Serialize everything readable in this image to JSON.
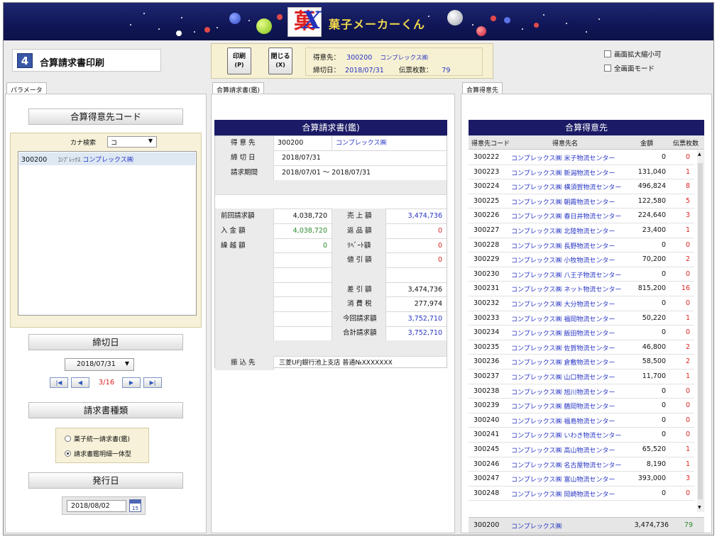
{
  "app": {
    "title": "菓子メーカーくん",
    "logo_text": "菓",
    "logo_x": "X"
  },
  "page": {
    "number": "4",
    "title": "合算請求書印刷"
  },
  "toolbar": {
    "print_label": "印刷",
    "print_key": "(P)",
    "close_label": "閉じる",
    "close_key": "(X)"
  },
  "info": {
    "customer_label": "得意先：",
    "customer_code": "300200",
    "customer_name": "コンプレックス㈱",
    "cutoff_label": "締切日：",
    "cutoff_date": "2018/07/31",
    "slip_label": "伝票枚数：",
    "slip_count": "79"
  },
  "options": {
    "zoom_label": "画面拡大縮小可",
    "fullscreen_label": "全画面モード"
  },
  "tabs": {
    "params": "パラメータ",
    "invoice": "合算請求書(鑑)",
    "customers": "合算得意先"
  },
  "left": {
    "code_header": "合算得意先コード",
    "kana_label": "カナ検索",
    "kana_value": "コ",
    "selected_code": "300200",
    "selected_kana": "ｺﾝﾌﾟﾚｯｸｽ",
    "selected_name": "コンプレックス㈱",
    "cutoff_header": "締切日",
    "cutoff_value": "2018/07/31",
    "nav_position": "3/16",
    "type_header": "請求書種類",
    "type_option1": "菓子統一請求書(鑑)",
    "type_option2": "請求書鑑明細一体型",
    "type_selected": 2,
    "issue_header": "発行日",
    "issue_value": "2018/08/02",
    "cal_label": "15"
  },
  "invoice": {
    "header": "合算請求書(鑑)",
    "customer_label": "得 意 先",
    "customer_code": "300200",
    "customer_name": "コンプレックス㈱",
    "cutoff_label": "締 切 日",
    "cutoff_value": "2018/07/31",
    "period_label": "請求期間",
    "period_value": "2018/07/01 ～ 2018/07/31",
    "prev_label": "前回請求額",
    "prev_value": "4,038,720",
    "received_label": "入 金 額",
    "received_value": "4,038,720",
    "carry_label": "繰 越 額",
    "carry_value": "0",
    "sales_label": "売 上 額",
    "sales_value": "3,474,736",
    "returns_label": "返 品 額",
    "returns_value": "0",
    "rebate_label": "ﾘﾍﾞｰﾄ額",
    "rebate_value": "0",
    "discount_label": "値 引 額",
    "discount_value": "0",
    "net_label": "差 引 額",
    "net_value": "3,474,736",
    "tax_label": "消 費 税",
    "tax_value": "277,974",
    "current_label": "今回請求額",
    "current_value": "3,752,710",
    "total_label": "合計請求額",
    "total_value": "3,752,710",
    "bank_label": "振 込 先",
    "bank_value": "三菱UFJ銀行池上支店 普通№XXXXXXX"
  },
  "customers": {
    "header": "合算得意先",
    "col_code": "得意先コード",
    "col_name": "得意先名",
    "col_amount": "金額",
    "col_count": "伝票枚数",
    "rows": [
      {
        "code": "300222",
        "name": "コンプレックス㈱ 米子物流センター",
        "amount": "0",
        "count": "0"
      },
      {
        "code": "300223",
        "name": "コンプレックス㈱ 新潟物流センター",
        "amount": "131,040",
        "count": "1"
      },
      {
        "code": "300224",
        "name": "コンプレックス㈱ 横須賀物流センター",
        "amount": "496,824",
        "count": "8"
      },
      {
        "code": "300225",
        "name": "コンプレックス㈱ 朝霞物流センター",
        "amount": "122,580",
        "count": "5"
      },
      {
        "code": "300226",
        "name": "コンプレックス㈱ 春日井物流センター",
        "amount": "224,640",
        "count": "3"
      },
      {
        "code": "300227",
        "name": "コンプレックス㈱ 北陸物流センター",
        "amount": "23,400",
        "count": "1"
      },
      {
        "code": "300228",
        "name": "コンプレックス㈱ 長野物流センター",
        "amount": "0",
        "count": "0"
      },
      {
        "code": "300229",
        "name": "コンプレックス㈱ 小牧物流センター",
        "amount": "70,200",
        "count": "2"
      },
      {
        "code": "300230",
        "name": "コンプレックス㈱ 八王子物流センター",
        "amount": "0",
        "count": "0"
      },
      {
        "code": "300231",
        "name": "コンプレックス㈱ ネット物流センター",
        "amount": "815,200",
        "count": "16"
      },
      {
        "code": "300232",
        "name": "コンプレックス㈱ 大分物流センター",
        "amount": "0",
        "count": "0"
      },
      {
        "code": "300233",
        "name": "コンプレックス㈱ 福岡物流センター",
        "amount": "50,220",
        "count": "1"
      },
      {
        "code": "300234",
        "name": "コンプレックス㈱ 飯田物流センター",
        "amount": "0",
        "count": "0"
      },
      {
        "code": "300235",
        "name": "コンプレックス㈱ 佐賀物流センター",
        "amount": "46,800",
        "count": "2"
      },
      {
        "code": "300236",
        "name": "コンプレックス㈱ 倉敷物流センター",
        "amount": "58,500",
        "count": "2"
      },
      {
        "code": "300237",
        "name": "コンプレックス㈱ 山口物流センター",
        "amount": "11,700",
        "count": "1"
      },
      {
        "code": "300238",
        "name": "コンプレックス㈱ 旭川物流センター",
        "amount": "0",
        "count": "0"
      },
      {
        "code": "300239",
        "name": "コンプレックス㈱ 鶴岡物流センター",
        "amount": "0",
        "count": "0"
      },
      {
        "code": "300240",
        "name": "コンプレックス㈱ 福島物流センター",
        "amount": "0",
        "count": "0"
      },
      {
        "code": "300241",
        "name": "コンプレックス㈱ いわき物流センター",
        "amount": "0",
        "count": "0"
      },
      {
        "code": "300245",
        "name": "コンプレックス㈱ 高山物流センター",
        "amount": "65,520",
        "count": "1"
      },
      {
        "code": "300246",
        "name": "コンプレックス㈱ 名古屋物流センター",
        "amount": "8,190",
        "count": "1"
      },
      {
        "code": "300247",
        "name": "コンプレックス㈱ 富山物流センター",
        "amount": "393,000",
        "count": "3"
      },
      {
        "code": "300248",
        "name": "コンプレックス㈱ 岡崎物流センター",
        "amount": "0",
        "count": "0"
      }
    ],
    "footer_code": "300200",
    "footer_name": "コンプレックス㈱",
    "footer_amount": "3,474,736",
    "footer_count": "79"
  },
  "colors": {
    "banner": "#101656",
    "accent_blue": "#2634c4",
    "accent_red": "#dd2222",
    "accent_green": "#2e8b2e"
  }
}
